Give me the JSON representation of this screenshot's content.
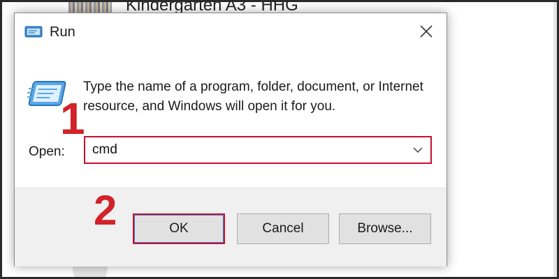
{
  "background_window": {
    "title": "Kindergarten A3 - HHG"
  },
  "dialog": {
    "title": "Run",
    "icon": "run-icon",
    "close_icon": "close-icon",
    "description": "Type the name of a program, folder, document, or Internet resource, and Windows will open it for you.",
    "open_label": "Open:",
    "open_value": "cmd",
    "buttons": {
      "ok": "OK",
      "cancel": "Cancel",
      "browse": "Browse..."
    }
  },
  "annotations": {
    "step1": "1",
    "step2": "2"
  },
  "colors": {
    "highlight": "#c8102e",
    "step_number": "#d2232a",
    "footer": "#f0f0f0",
    "button": "#e1e1e1"
  }
}
